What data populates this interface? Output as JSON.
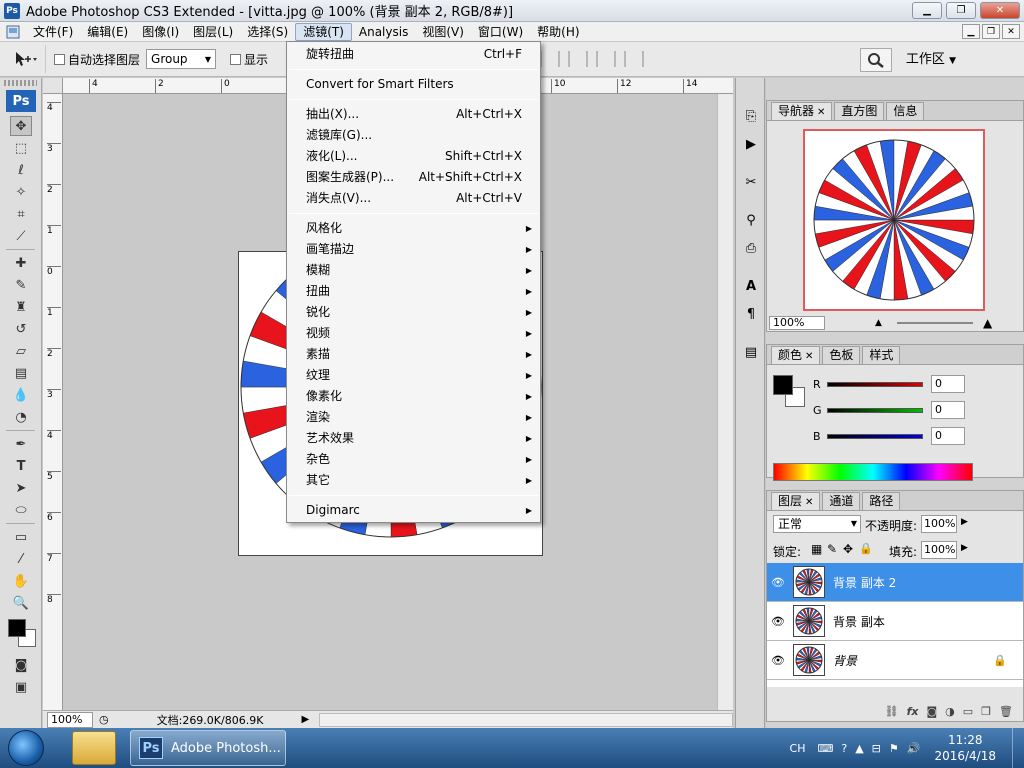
{
  "window": {
    "title": "Adobe Photoshop CS3 Extended - [vitta.jpg @ 100% (背景 副本 2, RGB/8#)]",
    "icon": "ps-icon",
    "controls": [
      "minimize",
      "maximize",
      "close"
    ]
  },
  "menubar": {
    "items": [
      {
        "label": "文件(F)"
      },
      {
        "label": "编辑(E)"
      },
      {
        "label": "图像(I)"
      },
      {
        "label": "图层(L)"
      },
      {
        "label": "选择(S)"
      },
      {
        "label": "滤镜(T)"
      },
      {
        "label": "Analysis"
      },
      {
        "label": "视图(V)"
      },
      {
        "label": "窗口(W)"
      },
      {
        "label": "帮助(H)"
      }
    ],
    "active_index": 5
  },
  "options_bar": {
    "auto_select_label": "自动选择图层",
    "auto_select_value": "Group",
    "show_transform_label": "显示",
    "workspace_label": "工作区"
  },
  "filter_menu": {
    "groups": [
      [
        {
          "label": "旋转扭曲",
          "shortcut": "Ctrl+F"
        }
      ],
      [
        {
          "label": "Convert for Smart Filters",
          "shortcut": ""
        }
      ],
      [
        {
          "label": "抽出(X)...",
          "shortcut": "Alt+Ctrl+X"
        },
        {
          "label": "滤镜库(G)...",
          "shortcut": ""
        },
        {
          "label": "液化(L)...",
          "shortcut": "Shift+Ctrl+X"
        },
        {
          "label": "图案生成器(P)...",
          "shortcut": "Alt+Shift+Ctrl+X"
        },
        {
          "label": "消失点(V)...",
          "shortcut": "Alt+Ctrl+V"
        }
      ],
      [
        {
          "label": "风格化",
          "submenu": true
        },
        {
          "label": "画笔描边",
          "submenu": true
        },
        {
          "label": "模糊",
          "submenu": true
        },
        {
          "label": "扭曲",
          "submenu": true
        },
        {
          "label": "锐化",
          "submenu": true
        },
        {
          "label": "视频",
          "submenu": true
        },
        {
          "label": "素描",
          "submenu": true
        },
        {
          "label": "纹理",
          "submenu": true
        },
        {
          "label": "像素化",
          "submenu": true
        },
        {
          "label": "渲染",
          "submenu": true
        },
        {
          "label": "艺术效果",
          "submenu": true
        },
        {
          "label": "杂色",
          "submenu": true
        },
        {
          "label": "其它",
          "submenu": true
        }
      ],
      [
        {
          "label": "Digimarc",
          "submenu": true
        }
      ]
    ]
  },
  "rulers": {
    "top_ticks": [
      "4",
      "2",
      "0",
      "2",
      "4",
      "6",
      "8",
      "10",
      "12",
      "14"
    ],
    "left_ticks": [
      "4",
      "3",
      "2",
      "1",
      "0",
      "1",
      "2",
      "3",
      "4",
      "5",
      "6",
      "7",
      "8"
    ]
  },
  "status": {
    "zoom": "100%",
    "doc_info": "文档:269.0K/806.9K"
  },
  "navigator": {
    "tabs": [
      "导航器",
      "直方图",
      "信息"
    ],
    "zoom": "100%"
  },
  "color_panel": {
    "tabs": [
      "颜色",
      "色板",
      "样式"
    ],
    "channels": [
      {
        "label": "R",
        "value": "0",
        "color": "#e00000"
      },
      {
        "label": "G",
        "value": "0",
        "color": "#00c000"
      },
      {
        "label": "B",
        "value": "0",
        "color": "#0000e0"
      }
    ]
  },
  "layers_panel": {
    "tabs": [
      "图层",
      "通道",
      "路径"
    ],
    "blend_mode": "正常",
    "opacity_label": "不透明度:",
    "opacity_value": "100%",
    "lock_label": "锁定:",
    "fill_label": "填充:",
    "fill_value": "100%",
    "layers": [
      {
        "name": "背景 副本 2",
        "selected": true,
        "locked": false
      },
      {
        "name": "背景 副本",
        "selected": false,
        "locked": false
      },
      {
        "name": "背景",
        "selected": false,
        "locked": true
      }
    ]
  },
  "taskbar": {
    "task_label": "Adobe Photosh...",
    "ime": "CH",
    "time": "11:28",
    "date": "2016/4/18"
  },
  "colors": {
    "stripe_red": "#e8141c",
    "stripe_blue": "#2b62e0",
    "selection": "#3d8fe8"
  }
}
